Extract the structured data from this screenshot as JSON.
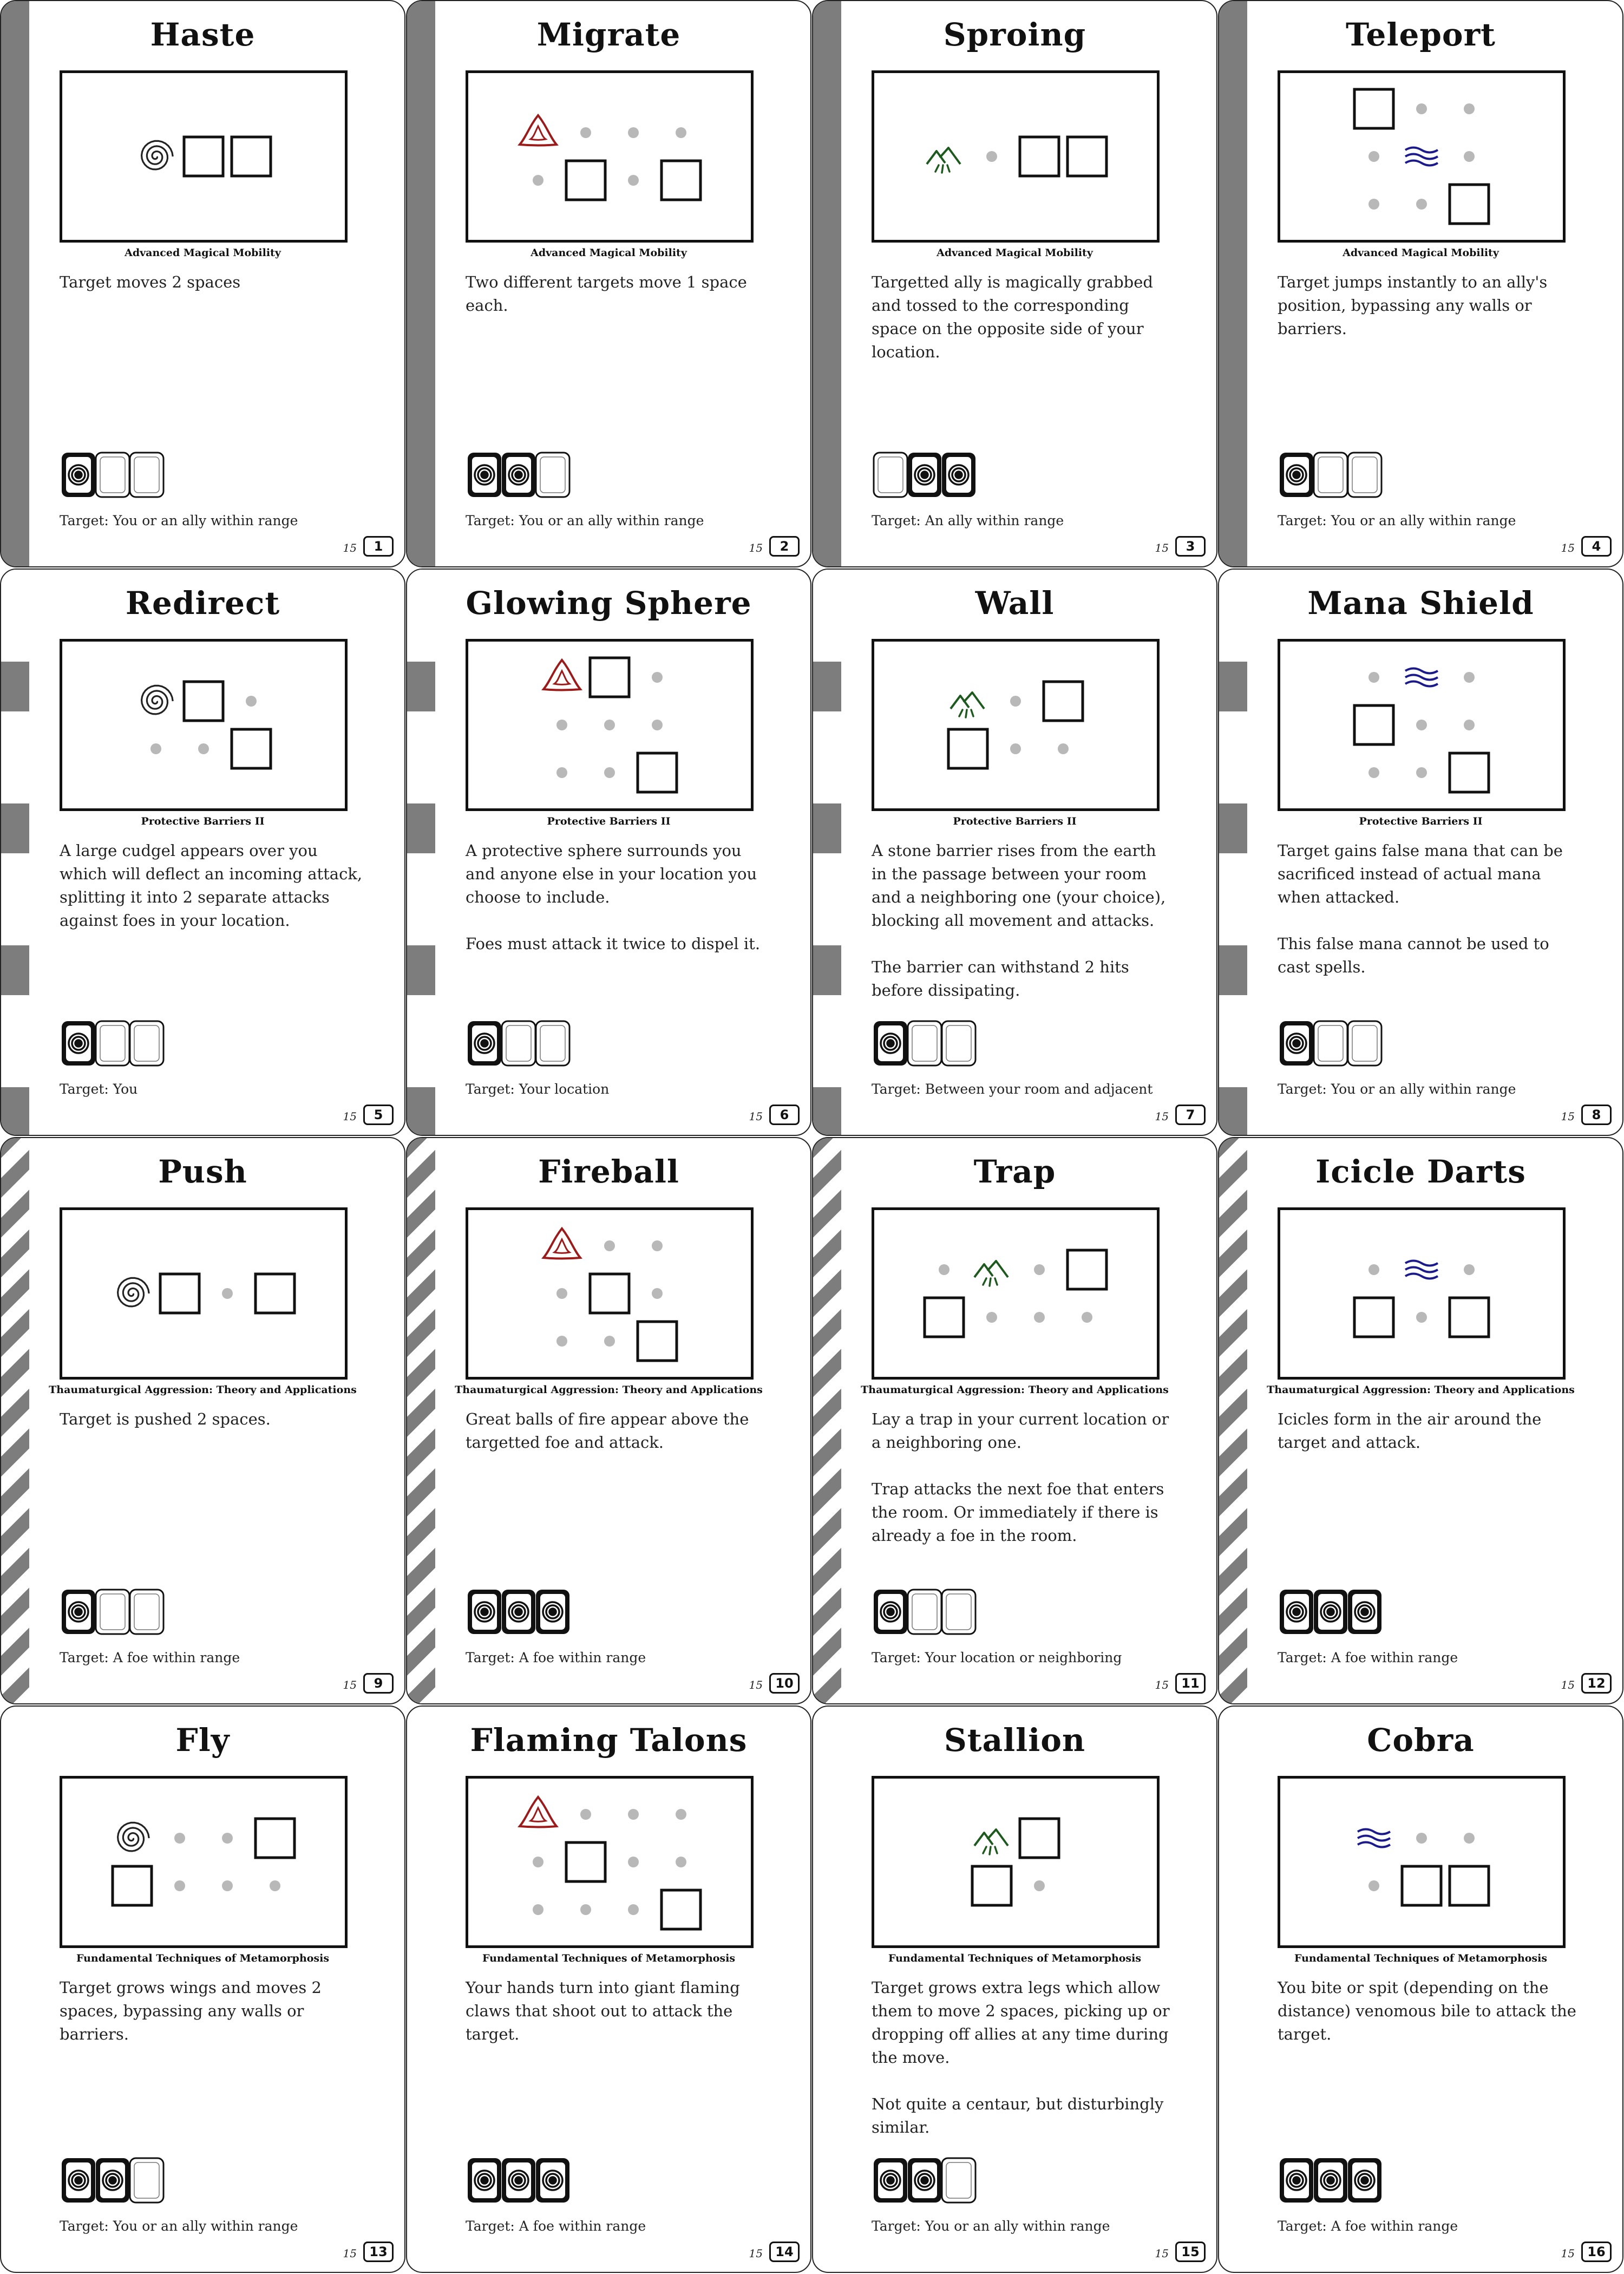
{
  "colors": {
    "red": "#9b1b1b",
    "green": "#1e5a1e",
    "blue": "#1a1a8c",
    "gray_dot": "#b8b8b8",
    "stripe": "#7d7d7d"
  },
  "cards": [
    {
      "title": "Haste",
      "course": "Advanced Magical Mobility",
      "stripe": "solid",
      "element": "spiral-icon",
      "desc": [
        "Target moves 2 spaces"
      ],
      "slots": [
        "filled",
        "empty",
        "empty"
      ],
      "target": "Target: You or an ally within range",
      "cost": "15",
      "number": "1",
      "grid": [
        "E S S"
      ]
    },
    {
      "title": "Migrate",
      "course": "Advanced Magical Mobility",
      "stripe": "solid",
      "element": "triquetra-icon",
      "desc": [
        "Two different targets move 1 space each."
      ],
      "slots": [
        "filled",
        "filled",
        "empty"
      ],
      "target": "Target: You or an ally within range",
      "cost": "15",
      "number": "2",
      "grid": [
        "E . . .",
        ". S . S"
      ]
    },
    {
      "title": "Sproing",
      "course": "Advanced Magical Mobility",
      "stripe": "solid",
      "element": "grass-icon",
      "desc": [
        "Targetted ally is magically grabbed and tossed to the corresponding space on the opposite side of your location."
      ],
      "slots": [
        "empty",
        "filled",
        "filled"
      ],
      "target": "Target: An ally within range",
      "cost": "15",
      "number": "3",
      "grid": [
        "E . S S"
      ]
    },
    {
      "title": "Teleport",
      "course": "Advanced Magical Mobility",
      "stripe": "solid",
      "element": "water-icon",
      "desc": [
        "Target jumps instantly to an ally's position, bypassing any walls or barriers."
      ],
      "slots": [
        "filled",
        "empty",
        "empty"
      ],
      "target": "Target: You or an ally within range",
      "cost": "15",
      "number": "4",
      "grid": [
        "S . .",
        ". E .",
        ". . S"
      ]
    },
    {
      "title": "Redirect",
      "course": "Protective Barriers II",
      "stripe": "blocks",
      "element": "spiral-icon",
      "desc": [
        "A large cudgel appears over you which will deflect an incoming attack, splitting it into 2 separate attacks against foes in your location."
      ],
      "slots": [
        "filled",
        "empty",
        "empty"
      ],
      "target": "Target: You",
      "cost": "15",
      "number": "5",
      "grid": [
        "E S .",
        ". . S"
      ]
    },
    {
      "title": "Glowing Sphere",
      "course": "Protective Barriers II",
      "stripe": "blocks",
      "element": "triquetra-icon",
      "desc": [
        "A protective sphere surrounds you and anyone else in your location you choose to include.",
        "Foes must attack it twice to dispel it."
      ],
      "slots": [
        "filled",
        "empty",
        "empty"
      ],
      "target": "Target: Your location",
      "cost": "15",
      "number": "6",
      "grid": [
        "E S .",
        ". . .",
        ". . S"
      ]
    },
    {
      "title": "Wall",
      "course": "Protective Barriers II",
      "stripe": "blocks",
      "element": "grass-icon",
      "desc": [
        "A stone barrier rises from the earth in the passage between your room and a neighboring one (your choice), blocking all movement and attacks.",
        "The barrier can withstand 2 hits before dissipating."
      ],
      "slots": [
        "filled",
        "empty",
        "empty"
      ],
      "target": "Target: Between your room and adjacent",
      "cost": "15",
      "number": "7",
      "grid": [
        "E . S",
        "S . ."
      ]
    },
    {
      "title": "Mana Shield",
      "course": "Protective Barriers II",
      "stripe": "blocks",
      "element": "water-icon",
      "desc": [
        "Target gains false mana that can be sacrificed instead of actual mana when attacked.",
        "This false mana cannot be used to cast spells."
      ],
      "slots": [
        "filled",
        "empty",
        "empty"
      ],
      "target": "Target: You or an ally within range",
      "cost": "15",
      "number": "8",
      "grid": [
        ". E .",
        "S . .",
        ". . S"
      ]
    },
    {
      "title": "Push",
      "course": "Thaumaturgical Aggression: Theory and Applications",
      "stripe": "diag",
      "element": "spiral-icon",
      "desc": [
        "Target is pushed 2 spaces."
      ],
      "slots": [
        "filled",
        "empty",
        "empty"
      ],
      "target": "Target: A foe within range",
      "cost": "15",
      "number": "9",
      "grid": [
        "E S . S"
      ]
    },
    {
      "title": "Fireball",
      "course": "Thaumaturgical Aggression: Theory and Applications",
      "stripe": "diag",
      "element": "triquetra-icon",
      "desc": [
        "Great balls of fire appear above the targetted foe and attack."
      ],
      "slots": [
        "filled",
        "filled",
        "filled"
      ],
      "target": "Target: A foe within range",
      "cost": "15",
      "number": "10",
      "grid": [
        "E . .",
        ". S .",
        ". . S"
      ]
    },
    {
      "title": "Trap",
      "course": "Thaumaturgical Aggression: Theory and Applications",
      "stripe": "diag",
      "element": "grass-icon",
      "desc": [
        "Lay a trap in your current location or a neighboring one.",
        "Trap attacks the next foe that enters the room. Or immediately if there is already a foe in the room."
      ],
      "slots": [
        "filled",
        "empty",
        "empty"
      ],
      "target": "Target: Your location or neighboring",
      "cost": "15",
      "number": "11",
      "grid": [
        ". E . S",
        "S . . ."
      ]
    },
    {
      "title": "Icicle Darts",
      "course": "Thaumaturgical Aggression: Theory and Applications",
      "stripe": "diag",
      "element": "water-icon",
      "desc": [
        "Icicles form in the air around the target and attack."
      ],
      "slots": [
        "filled",
        "filled",
        "filled"
      ],
      "target": "Target: A foe within range",
      "cost": "15",
      "number": "12",
      "grid": [
        ". E .",
        "S . S"
      ]
    },
    {
      "title": "Fly",
      "course": "Fundamental Techniques of Metamorphosis",
      "stripe": "none",
      "element": "spiral-icon",
      "desc": [
        "Target grows wings and moves 2 spaces, bypassing any walls or barriers."
      ],
      "slots": [
        "filled",
        "filled",
        "empty"
      ],
      "target": "Target: You or an ally within range",
      "cost": "15",
      "number": "13",
      "grid": [
        "E . . S",
        "S . . ."
      ]
    },
    {
      "title": "Flaming Talons",
      "course": "Fundamental Techniques of Metamorphosis",
      "stripe": "none",
      "element": "triquetra-icon",
      "desc": [
        "Your hands turn into giant flaming claws that shoot out to attack the target."
      ],
      "slots": [
        "filled",
        "filled",
        "filled"
      ],
      "target": "Target: A foe within range",
      "cost": "15",
      "number": "14",
      "grid": [
        "E . . .",
        ". S . .",
        ". . . S"
      ]
    },
    {
      "title": "Stallion",
      "course": "Fundamental Techniques of Metamorphosis",
      "stripe": "none",
      "element": "grass-icon",
      "desc": [
        "Target grows extra legs which allow them to move 2 spaces, picking up or dropping off allies at any time during the move.",
        "Not quite a centaur, but disturbingly similar."
      ],
      "slots": [
        "filled",
        "filled",
        "empty"
      ],
      "target": "Target: You or an ally within range",
      "cost": "15",
      "number": "15",
      "grid": [
        "E S",
        "S ."
      ]
    },
    {
      "title": "Cobra",
      "course": "Fundamental Techniques of Metamorphosis",
      "stripe": "none",
      "element": "water-icon",
      "desc": [
        "You bite or spit (depending on the distance) venomous bile to attack the target."
      ],
      "slots": [
        "filled",
        "filled",
        "filled"
      ],
      "target": "Target: A foe within range",
      "cost": "15",
      "number": "16",
      "grid": [
        "E . .",
        ". S S"
      ]
    }
  ]
}
